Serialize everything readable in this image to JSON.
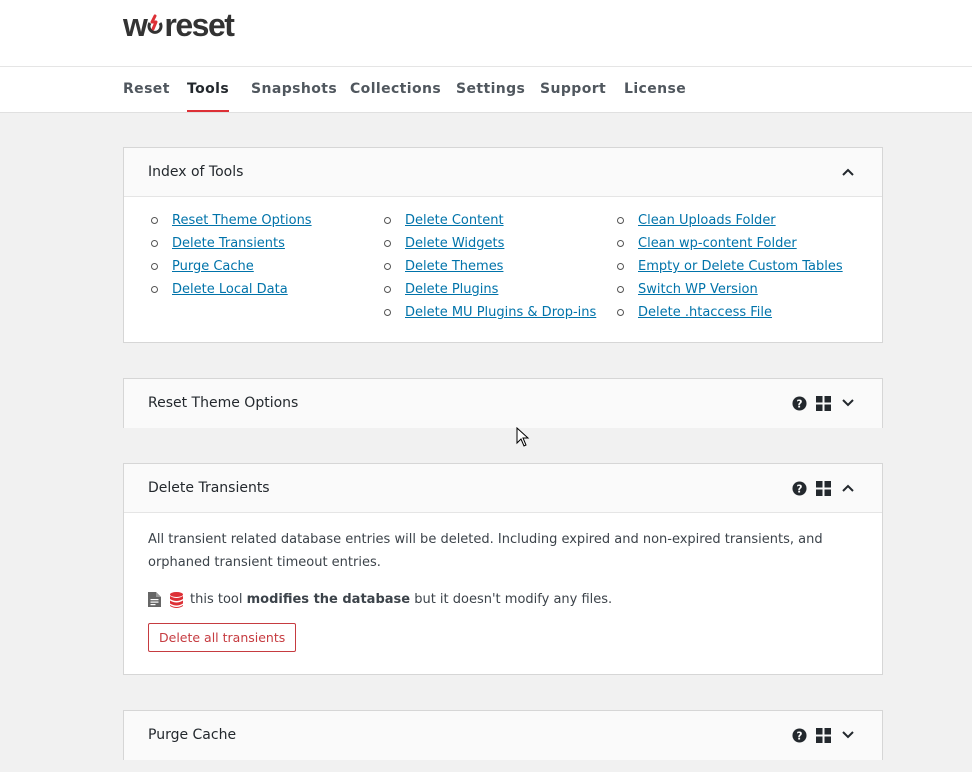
{
  "brand": {
    "logo_text_left": "w",
    "logo_text_right": "reset"
  },
  "nav": {
    "tabs": [
      {
        "label": "Reset"
      },
      {
        "label": "Tools"
      },
      {
        "label": "Snapshots"
      },
      {
        "label": "Collections"
      },
      {
        "label": "Settings"
      },
      {
        "label": "Support"
      },
      {
        "label": "License"
      }
    ],
    "active": "Tools"
  },
  "index": {
    "title": "Index of Tools",
    "columns": [
      [
        "Reset Theme Options",
        "Delete Transients",
        "Purge Cache",
        "Delete Local Data"
      ],
      [
        "Delete Content",
        "Delete Widgets",
        "Delete Themes",
        "Delete Plugins",
        "Delete MU Plugins & Drop-ins"
      ],
      [
        "Clean Uploads Folder",
        "Clean wp-content Folder",
        "Empty or Delete Custom Tables",
        "Switch WP Version",
        "Delete .htaccess File"
      ]
    ]
  },
  "cards": {
    "reset_theme": {
      "title": "Reset Theme Options"
    },
    "delete_transients": {
      "title": "Delete Transients",
      "description": "All transient related database entries will be deleted. Including expired and non-expired transients, and orphaned transient timeout entries.",
      "info_prefix": "this tool ",
      "info_bold": "modifies the database",
      "info_suffix": " but it doesn't modify any files.",
      "button_label": "Delete all transients"
    },
    "purge_cache": {
      "title": "Purge Cache"
    }
  },
  "colors": {
    "accent": "#dd3036",
    "link": "#0073aa",
    "danger": "#c63b40"
  }
}
